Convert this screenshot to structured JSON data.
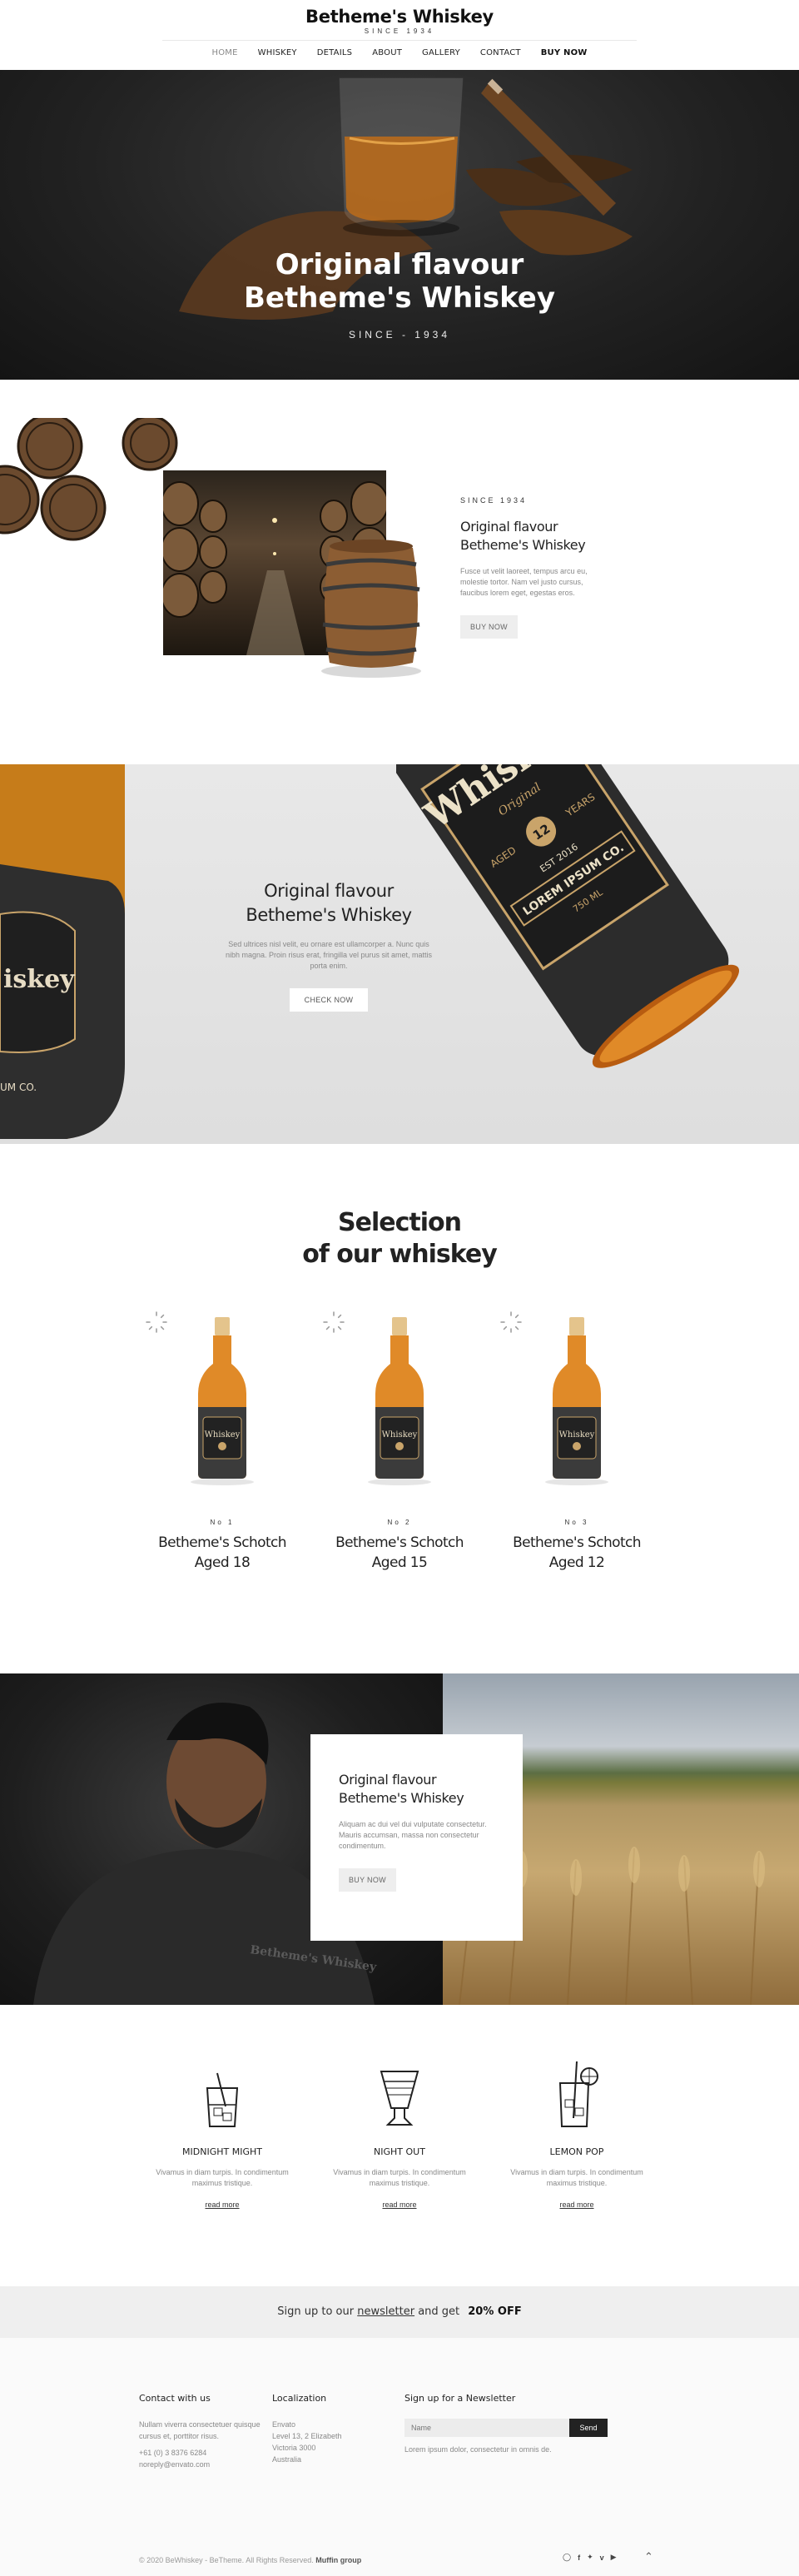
{
  "header": {
    "logo_title": "Betheme's Whiskey",
    "logo_subtitle": "SINCE 1934",
    "nav": [
      {
        "label": "HOME",
        "state": "active"
      },
      {
        "label": "WHISKEY"
      },
      {
        "label": "DETAILS"
      },
      {
        "label": "ABOUT"
      },
      {
        "label": "GALLERY"
      },
      {
        "label": "CONTACT"
      },
      {
        "label": "BUY NOW",
        "style": "bold"
      }
    ]
  },
  "hero": {
    "title_line1": "Original flavour",
    "title_line2": "Betheme's Whiskey",
    "since": "SINCE - 1934"
  },
  "story": {
    "overline": "SINCE 1934",
    "title_line1": "Original flavour",
    "title_line2": "Betheme's Whiskey",
    "text": "Fusce ut velit laoreet, tempus arcu eu, molestie tortor. Nam vel justo cursus, faucibus lorem eget, egestas eros.",
    "button": "BUY NOW"
  },
  "feature": {
    "title_line1": "Original flavour",
    "title_line2": "Betheme's Whiskey",
    "text": "Sed ultrices nisl velit, eu ornare est ullamcorper a. Nunc quis nibh magna. Proin risus erat, fringilla vel purus sit amet, mattis porta enim.",
    "button": "CHECK NOW",
    "bottle_label": {
      "brand": "Whiskey",
      "script": "Original",
      "years": "12",
      "years_word": "YEARS",
      "aged": "AGED",
      "est": "EST 2016",
      "name": "LOREM IPSUM CO.",
      "volume": "750 ML"
    }
  },
  "selection": {
    "title_line1": "Selection",
    "title_line2": "of our whiskey",
    "products": [
      {
        "num": "No 1",
        "name_line1": "Betheme's Schotch",
        "name_line2": "Aged 18"
      },
      {
        "num": "No 2",
        "name_line1": "Betheme's Schotch",
        "name_line2": "Aged 15"
      },
      {
        "num": "No 3",
        "name_line1": "Betheme's Schotch",
        "name_line2": "Aged 12"
      }
    ]
  },
  "promo": {
    "title_line1": "Original flavour",
    "title_line2": "Betheme's Whiskey",
    "text": "Aliquam ac dui vel dui vulputate consectetur. Mauris accumsan, massa non consectetur condimentum.",
    "button": "BUY NOW",
    "shirt_text": "Betheme's Whiskey"
  },
  "drinks": [
    {
      "icon": "cocktail-glass-icon",
      "title": "MIDNIGHT MIGHT",
      "text": "Vivamus in diam turpis. In condimentum maximus tristique.",
      "link": "read more"
    },
    {
      "icon": "shot-glass-icon",
      "title": "NIGHT OUT",
      "text": "Vivamus in diam turpis. In condimentum maximus tristique.",
      "link": "read more"
    },
    {
      "icon": "lemon-drink-icon",
      "title": "LEMON POP",
      "text": "Vivamus in diam turpis. In condimentum maximus tristique.",
      "link": "read more"
    }
  ],
  "newsletter_bar": {
    "prefix": "Sign up to our",
    "link": "newsletter",
    "middle": "and get",
    "offer": "20% OFF"
  },
  "footer": {
    "contact": {
      "title": "Contact with us",
      "text": "Nullam viverra consectetuer quisque cursus et, porttitor risus.",
      "phone": "+61 (0) 3 8376 6284",
      "email": "noreply@envato.com"
    },
    "localization": {
      "title": "Localization",
      "lines": [
        "Envato",
        "Level 13, 2 Elizabeth",
        "Victoria 3000",
        "Australia"
      ]
    },
    "newsletter": {
      "title": "Sign up for a Newsletter",
      "placeholder": "Name",
      "button": "Send",
      "text": "Lorem ipsum dolor, consectetur in omnis de."
    },
    "copyright_prefix": "© 2020 BeWhiskey - BeTheme. All Rights Reserved.",
    "copyright_brand": "Muffin group",
    "socials": [
      "skype-icon",
      "facebook-icon",
      "twitter-icon",
      "vimeo-icon",
      "youtube-icon"
    ],
    "colors": {
      "accent": "#222222",
      "bar": "#efefef"
    }
  }
}
